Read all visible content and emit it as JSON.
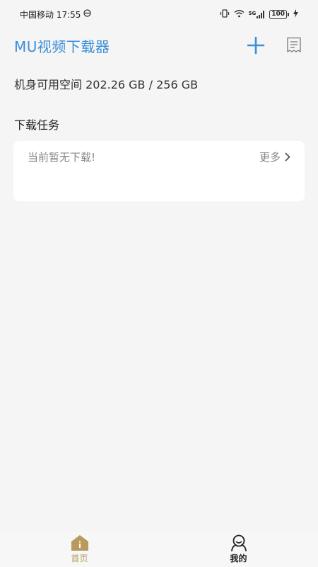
{
  "status_bar": {
    "carrier_time": "中国移动 17:55",
    "network": "5G",
    "battery": "100"
  },
  "header": {
    "title": "MU视频下载器",
    "add_icon": "plus-icon",
    "list_icon": "receipt-icon"
  },
  "storage": {
    "text": "机身可用空间 202.26 GB / 256 GB"
  },
  "tasks": {
    "section_title": "下载任务",
    "empty_text": "当前暂无下载!",
    "more_label": "更多"
  },
  "nav": {
    "items": [
      {
        "label": "首页",
        "icon": "home-icon",
        "active": true
      },
      {
        "label": "我的",
        "icon": "user-icon",
        "active": false
      }
    ]
  },
  "colors": {
    "accent": "#3a8fd9",
    "nav_active": "#b89a5e",
    "background": "#f5f5f5"
  }
}
